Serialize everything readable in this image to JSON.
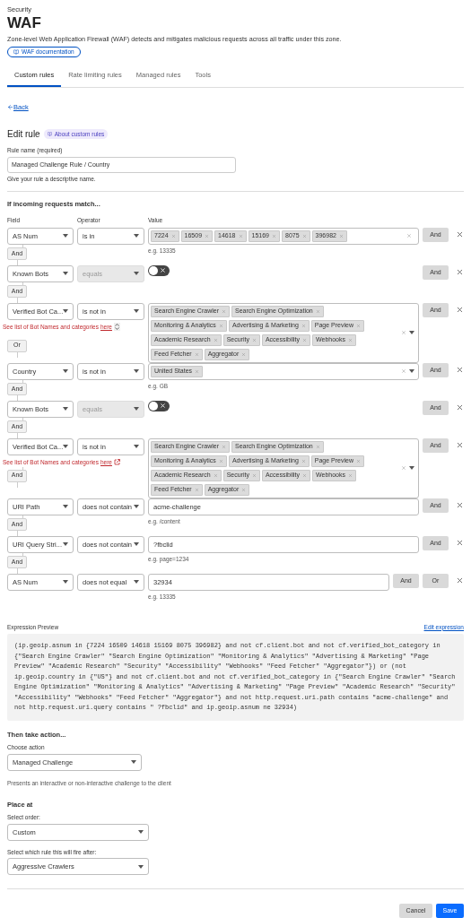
{
  "header": {
    "breadcrumb": "Security",
    "title": "WAF",
    "description": "Zone-level Web Application Firewall (WAF) detects and mitigates malicious requests across all traffic under this zone.",
    "doc_button": "WAF documentation"
  },
  "tabs": [
    {
      "label": "Custom rules",
      "selected": true
    },
    {
      "label": "Rate limiting rules",
      "selected": false
    },
    {
      "label": "Managed rules",
      "selected": false
    },
    {
      "label": "Tools",
      "selected": false
    }
  ],
  "back_link": "Back",
  "edit": {
    "title": "Edit rule",
    "about_badge": "About custom rules",
    "rule_name_label": "Rule name (required)",
    "rule_name_value": "Managed Challenge Rule / Country",
    "rule_name_hint": "Give your rule a descriptive name."
  },
  "match": {
    "title": "If incoming requests match...",
    "columns": [
      "Field",
      "Operator",
      "Value"
    ],
    "conditions": [
      {
        "field": "AS Num",
        "operator": "is in",
        "operator_disabled": false,
        "kind": "tags",
        "tags": [
          "7224",
          "16509",
          "14618",
          "15169",
          "8075",
          "396982"
        ],
        "dropdown": false,
        "hint": "e.g. 13335",
        "buttons": [
          "And"
        ],
        "connector": "And"
      },
      {
        "field": "Known Bots",
        "operator": "equals",
        "operator_disabled": true,
        "kind": "toggle",
        "on": false,
        "buttons": [
          "And"
        ],
        "connector": "And"
      },
      {
        "field": "Verified Bot Ca...",
        "operator": "is not in",
        "operator_disabled": false,
        "kind": "tags",
        "tags": [
          "Search Engine Crawler",
          "Search Engine Optimization",
          "Monitoring & Analytics",
          "Advertising & Marketing",
          "Page Preview",
          "Academic Research",
          "Security",
          "Accessibility",
          "Webhooks",
          "Feed Fetcher",
          "Aggregator"
        ],
        "dropdown": true,
        "note": {
          "text": "See list of Bot Names and categories",
          "link": "here",
          "kind": "stepper"
        },
        "buttons": [
          "And"
        ],
        "connector": "Or"
      },
      {
        "field": "Country",
        "operator": "is not in",
        "operator_disabled": false,
        "kind": "tags",
        "tags": [
          "United States"
        ],
        "dropdown": true,
        "hint": "e.g. GB",
        "buttons": [
          "And"
        ],
        "connector": "And"
      },
      {
        "field": "Known Bots",
        "operator": "equals",
        "operator_disabled": true,
        "kind": "toggle",
        "on": false,
        "buttons": [
          "And"
        ],
        "connector": "And"
      },
      {
        "field": "Verified Bot Ca...",
        "operator": "is not in",
        "operator_disabled": false,
        "kind": "tags",
        "tags": [
          "Search Engine Crawler",
          "Search Engine Optimization",
          "Monitoring & Analytics",
          "Advertising & Marketing",
          "Page Preview",
          "Academic Research",
          "Security",
          "Accessibility",
          "Webhooks",
          "Feed Fetcher",
          "Aggregator"
        ],
        "dropdown": true,
        "note": {
          "text": "See list of Bot Names and categories",
          "link": "here",
          "kind": "external"
        },
        "buttons": [
          "And"
        ],
        "connector": "And"
      },
      {
        "field": "URI Path",
        "operator": "does not contain",
        "operator_disabled": false,
        "kind": "text",
        "value": "acme-challenge",
        "hint": "e.g. /content",
        "buttons": [
          "And"
        ],
        "connector": "And"
      },
      {
        "field": "URI Query Stri...",
        "operator": "does not contain",
        "operator_disabled": false,
        "kind": "text",
        "value": "?fbclid",
        "hint": "e.g. page=1234",
        "buttons": [
          "And"
        ],
        "connector": "And"
      },
      {
        "field": "AS Num",
        "operator": "does not equal",
        "operator_disabled": false,
        "kind": "text",
        "value": "32934",
        "hint": "e.g. 13335",
        "buttons": [
          "And",
          "Or"
        ]
      }
    ]
  },
  "expression": {
    "label": "Expression Preview",
    "edit_link": "Edit expression",
    "code": "(ip.geoip.asnum in {7224 16509 14618 15169 8075 396982} and not cf.client.bot and not cf.verified_bot_category in {\"Search Engine Crawler\" \"Search Engine Optimization\" \"Monitoring & Analytics\" \"Advertising & Marketing\" \"Page Preview\" \"Academic Research\" \"Security\" \"Accessibility\" \"Webhooks\" \"Feed Fetcher\" \"Aggregator\"}) or (not ip.geoip.country in {\"US\"} and not cf.client.bot and not cf.verified_bot_category in {\"Search Engine Crawler\" \"Search Engine Optimization\" \"Monitoring & Analytics\" \"Advertising & Marketing\" \"Page Preview\" \"Academic Research\" \"Security\" \"Accessibility\" \"Webhooks\" \"Feed Fetcher\" \"Aggregator\"} and not http.request.uri.path contains \"acme-challenge\" and not http.request.uri.query contains \" ?fbclid\" and ip.geoip.asnum ne 32934)"
  },
  "action": {
    "title": "Then take action...",
    "label": "Choose action",
    "value": "Managed Challenge",
    "description": "Presents an interactive or non-interactive challenge to the client"
  },
  "place": {
    "title": "Place at",
    "order_label": "Select order:",
    "order_value": "Custom",
    "after_label": "Select which rule this will fire after:",
    "after_value": "Aggressive Crawlers"
  },
  "footer": {
    "cancel": "Cancel",
    "save": "Save"
  }
}
